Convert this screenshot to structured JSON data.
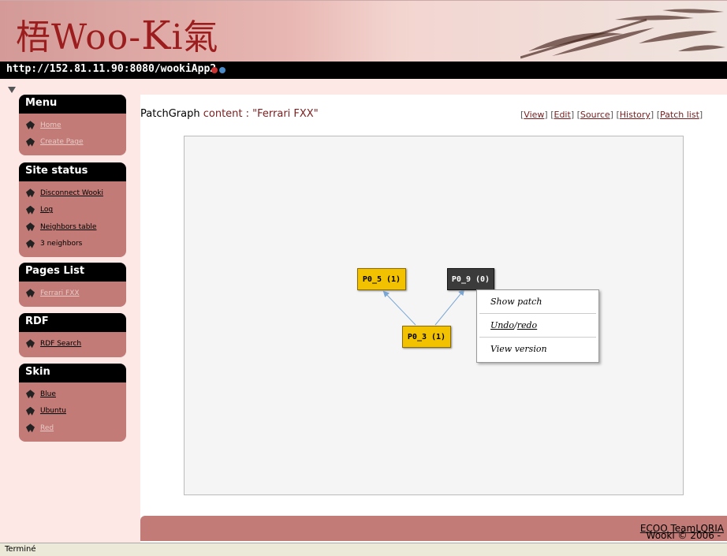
{
  "banner": {
    "logo_prefix": "梧Woo-",
    "logo_k": "K",
    "logo_suffix": "i氣"
  },
  "urlbar": {
    "url": "http://152.81.11.90:8080/wookiApp2"
  },
  "sidebar": {
    "menu": {
      "title": "Menu",
      "items": [
        "Home",
        "Create Page"
      ]
    },
    "site_status": {
      "title": "Site status",
      "items": [
        "Disconnect Wooki",
        "Log",
        "Neighbors table",
        "3 neighbors"
      ]
    },
    "pages_list": {
      "title": "Pages List",
      "items": [
        "Ferrari FXX"
      ]
    },
    "rdf": {
      "title": "RDF",
      "items": [
        "RDF Search"
      ]
    },
    "skin": {
      "title": "Skin",
      "items": [
        "Blue",
        "Ubuntu",
        "Red"
      ]
    }
  },
  "page": {
    "title_prefix": "PatchGraph",
    "title_sub": " content : ",
    "title_name": "\"Ferrari FXX\"",
    "links": [
      "View",
      "Edit",
      "Source",
      "History",
      "Patch list"
    ]
  },
  "graph": {
    "nodes": [
      {
        "label": "P0_5 (1)",
        "color": "#f2c200"
      },
      {
        "label": "P0_9 (0)",
        "color": "#3b3b3b"
      },
      {
        "label": "P0_3 (1)",
        "color": "#f2c200"
      }
    ],
    "context_menu": {
      "show_patch": "Show patch",
      "undo": "Undo",
      "sep": " / ",
      "redo": "redo",
      "view_version": "View version"
    }
  },
  "footer": {
    "text": "Wooki © 2006 - ",
    "team": "ECOO Team",
    "sep": " - ",
    "loria": "LORIA"
  },
  "status_bar": {
    "text": "Terminé"
  },
  "colors": {
    "accent": "#c27b76",
    "sidebar_bg": "#fde8e6",
    "header_dark": "#000000"
  }
}
